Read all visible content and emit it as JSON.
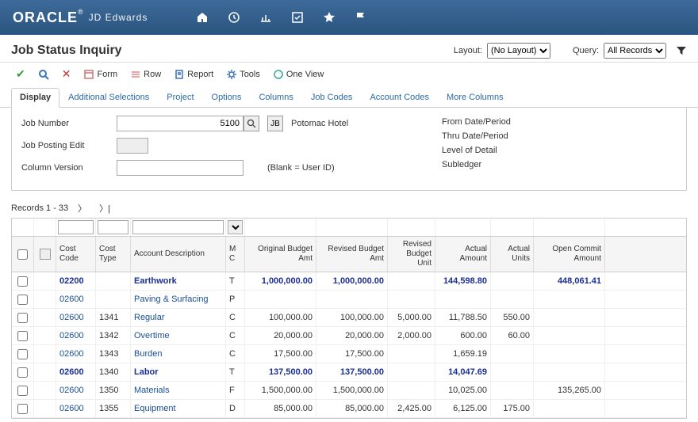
{
  "brand": {
    "name": "ORACLE",
    "product": "JD Edwards"
  },
  "page_title": "Job Status Inquiry",
  "layout": {
    "label": "Layout:",
    "value": "(No Layout)"
  },
  "query": {
    "label": "Query:",
    "value": "All Records"
  },
  "toolbar": {
    "form": "Form",
    "row": "Row",
    "report": "Report",
    "tools": "Tools",
    "oneview": "One View"
  },
  "tabs": [
    "Display",
    "Additional Selections",
    "Project",
    "Options",
    "Columns",
    "Job Codes",
    "Account Codes",
    "More Columns"
  ],
  "form": {
    "job_number_label": "Job Number",
    "job_number_value": "5100",
    "jb_label": "JB",
    "job_desc": "Potomac Hotel",
    "job_posting_label": "Job Posting Edit",
    "column_version_label": "Column Version",
    "blank_hint": "(Blank = User ID)"
  },
  "form_right": [
    "From Date/Period",
    "Thru Date/Period",
    "Level of Detail",
    "Subledger"
  ],
  "records_label": "Records 1 - 33",
  "columns": {
    "cost_code": "Cost Code",
    "cost_type": "Cost Type",
    "account_desc": "Account Description",
    "mc": "M C",
    "orig_budget": "Original Budget Amt",
    "rev_budget": "Revised Budget Amt",
    "rev_unit": "Revised Budget Unit",
    "actual_amt": "Actual Amount",
    "actual_units": "Actual Units",
    "open_commit": "Open Commit Amount"
  },
  "rows": [
    {
      "bold": true,
      "cost_code": "02200",
      "cost_type": "",
      "desc": "Earthwork",
      "mc": "T",
      "orig": "1,000,000.00",
      "rev": "1,000,000.00",
      "revu": "",
      "act": "144,598.80",
      "actu": "",
      "open": "448,061.41"
    },
    {
      "bold": false,
      "cost_code": "02600",
      "cost_type": "",
      "desc": "Paving & Surfacing",
      "mc": "P",
      "orig": "",
      "rev": "",
      "revu": "",
      "act": "",
      "actu": "",
      "open": ""
    },
    {
      "bold": false,
      "cost_code": "02600",
      "cost_type": "1341",
      "desc": "Regular",
      "mc": "C",
      "orig": "100,000.00",
      "rev": "100,000.00",
      "revu": "5,000.00",
      "act": "11,788.50",
      "actu": "550.00",
      "open": ""
    },
    {
      "bold": false,
      "cost_code": "02600",
      "cost_type": "1342",
      "desc": "Overtime",
      "mc": "C",
      "orig": "20,000.00",
      "rev": "20,000.00",
      "revu": "2,000.00",
      "act": "600.00",
      "actu": "60.00",
      "open": ""
    },
    {
      "bold": false,
      "cost_code": "02600",
      "cost_type": "1343",
      "desc": "Burden",
      "mc": "C",
      "orig": "17,500.00",
      "rev": "17,500.00",
      "revu": "",
      "act": "1,659.19",
      "actu": "",
      "open": ""
    },
    {
      "bold": true,
      "cost_code": "02600",
      "cost_type": "1340",
      "desc": "Labor",
      "mc": "T",
      "orig": "137,500.00",
      "rev": "137,500.00",
      "revu": "",
      "act": "14,047.69",
      "actu": "",
      "open": ""
    },
    {
      "bold": false,
      "cost_code": "02600",
      "cost_type": "1350",
      "desc": "Materials",
      "mc": "F",
      "orig": "1,500,000.00",
      "rev": "1,500,000.00",
      "revu": "",
      "act": "10,025.00",
      "actu": "",
      "open": "135,265.00"
    },
    {
      "bold": false,
      "cost_code": "02600",
      "cost_type": "1355",
      "desc": "Equipment",
      "mc": "D",
      "orig": "85,000.00",
      "rev": "85,000.00",
      "revu": "2,425.00",
      "act": "6,125.00",
      "actu": "175.00",
      "open": ""
    }
  ]
}
